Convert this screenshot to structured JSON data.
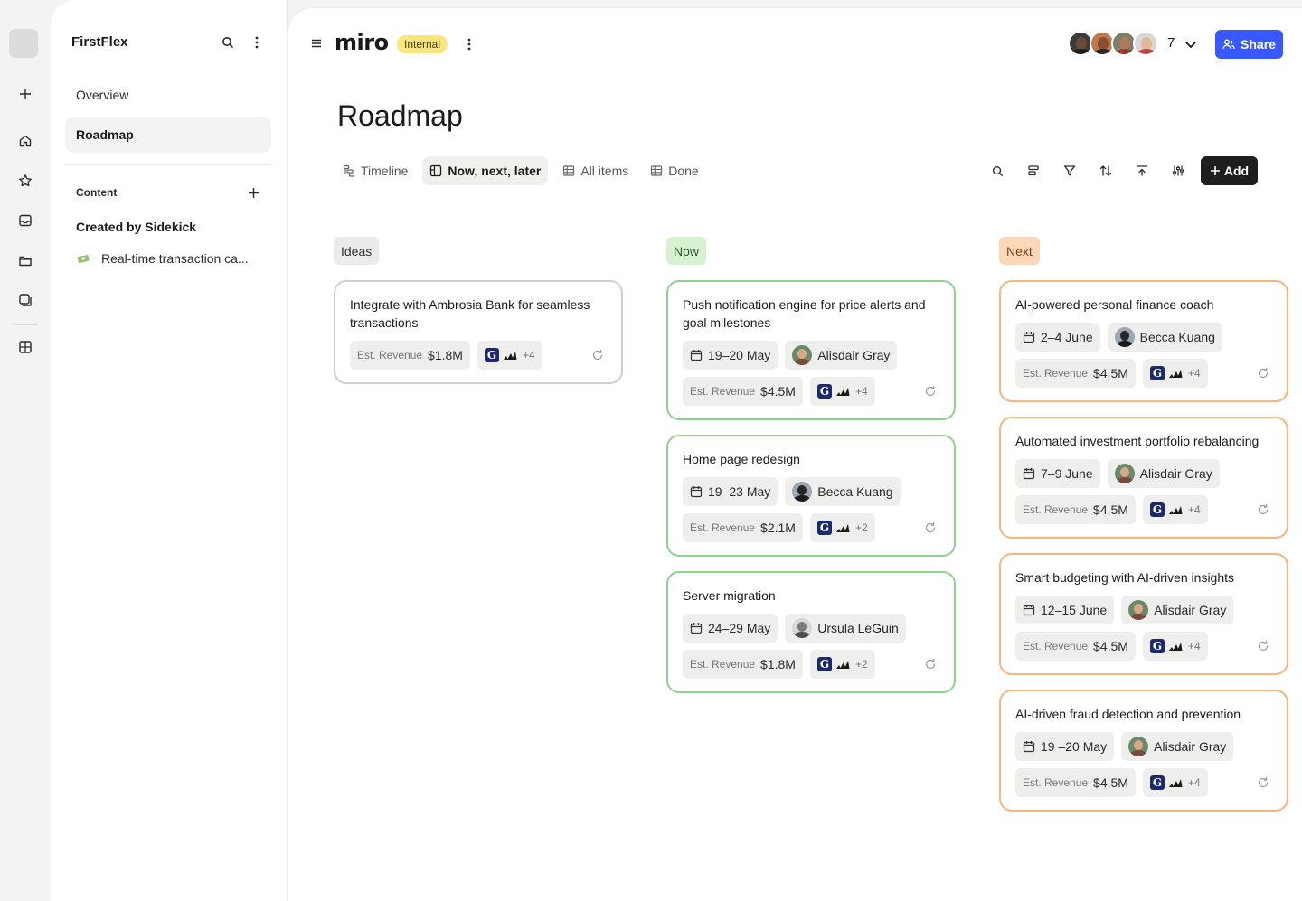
{
  "sidebar": {
    "workspace": "FirstFlex",
    "nav": [
      {
        "label": "Overview",
        "active": false
      },
      {
        "label": "Roadmap",
        "active": true
      }
    ],
    "content_section": "Content",
    "created_by": "Created by Sidekick",
    "doc_item": "Real-time transaction ca..."
  },
  "header": {
    "logo": "miro",
    "badge": "Internal",
    "collaborator_count": "7",
    "share_label": "Share"
  },
  "page": {
    "title": "Roadmap",
    "tabs": [
      {
        "label": "Timeline",
        "icon": "timeline-icon",
        "active": false
      },
      {
        "label": "Now, next, later",
        "icon": "board-icon",
        "active": true
      },
      {
        "label": "All items",
        "icon": "table-icon",
        "active": false
      },
      {
        "label": "Done",
        "icon": "table-icon",
        "active": false
      }
    ],
    "add_label": "Add"
  },
  "colors": {
    "ideas_border": "#cfcfcd",
    "ideas_bg": "#ebebe9",
    "now_border": "#8fd18f",
    "now_bg": "#d6f2d0",
    "next_border": "#f6b57a",
    "next_bg": "#fcd8b8",
    "accent": "#3859ff"
  },
  "revenue_label": "Est. Revenue",
  "columns": [
    {
      "label": "Ideas",
      "key": "ideas",
      "cards": [
        {
          "title": "Integrate with Ambrosia Bank for seamless transactions",
          "date": "",
          "owner": "",
          "revenue": "$1.8M",
          "more": "+4"
        }
      ]
    },
    {
      "label": "Now",
      "key": "now",
      "cards": [
        {
          "title": "Push notification engine for price alerts and goal milestones",
          "date": "19–20 May",
          "owner": "Alisdair Gray",
          "revenue": "$4.5M",
          "more": "+4"
        },
        {
          "title": "Home page redesign",
          "date": "19–23 May",
          "owner": "Becca Kuang",
          "revenue": "$2.1M",
          "more": "+2"
        },
        {
          "title": "Server migration",
          "date": "24–29 May",
          "owner": "Ursula LeGuin",
          "revenue": "$1.8M",
          "more": "+2"
        }
      ]
    },
    {
      "label": "Next",
      "key": "next",
      "cards": [
        {
          "title": "AI-powered personal finance coach",
          "date": "2–4 June",
          "owner": "Becca Kuang",
          "revenue": "$4.5M",
          "more": "+4"
        },
        {
          "title": "Automated investment portfolio rebalancing",
          "date": "7–9 June",
          "owner": "Alisdair Gray",
          "revenue": "$4.5M",
          "more": "+4"
        },
        {
          "title": "Smart budgeting with AI-driven insights",
          "date": "12–15 June",
          "owner": "Alisdair Gray",
          "revenue": "$4.5M",
          "more": "+4"
        },
        {
          "title": "AI-driven fraud detection and prevention",
          "date": "19 –20 May",
          "owner": "Alisdair Gray",
          "revenue": "$4.5M",
          "more": "+4"
        }
      ]
    }
  ]
}
